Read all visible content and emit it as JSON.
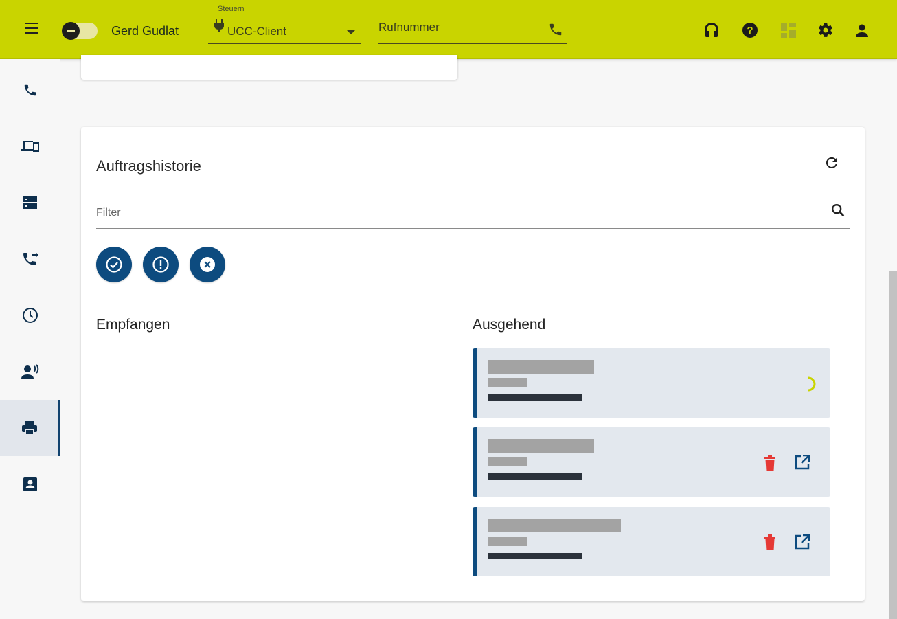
{
  "header": {
    "user_name": "Gerd Gudlat",
    "steuern_label": "Steuern",
    "steuern_value": "UCC-Client",
    "rufnummer_placeholder": "Rufnummer",
    "icons": [
      "headset-icon",
      "help-icon",
      "dashboard-icon",
      "settings-icon",
      "person-icon"
    ]
  },
  "sidebar": {
    "items": [
      {
        "icon": "phone-icon"
      },
      {
        "icon": "devices-icon"
      },
      {
        "icon": "storage-icon"
      },
      {
        "icon": "call-forward-icon"
      },
      {
        "icon": "clock-icon"
      },
      {
        "icon": "voice-user-icon"
      },
      {
        "icon": "printer-icon",
        "active": true
      },
      {
        "icon": "contact-card-icon"
      }
    ]
  },
  "history": {
    "title": "Auftragshistorie",
    "filter_placeholder": "Filter",
    "status_filters": [
      "check-circle-icon",
      "alert-circle-icon",
      "cancel-circle-icon"
    ],
    "received_heading": "Empfangen",
    "outgoing_heading": "Ausgehend",
    "outgoing_jobs": [
      {
        "status": "loading",
        "actions": []
      },
      {
        "status": "done",
        "actions": [
          "delete-icon",
          "open-external-icon"
        ]
      },
      {
        "status": "done",
        "actions": [
          "delete-icon",
          "open-external-icon"
        ]
      }
    ]
  },
  "colors": {
    "header_bg": "#c9d400",
    "primary": "#0d4b7f",
    "delete": "#e53935",
    "spinner": "#c9d400",
    "job_bg": "#e3e8ee"
  }
}
